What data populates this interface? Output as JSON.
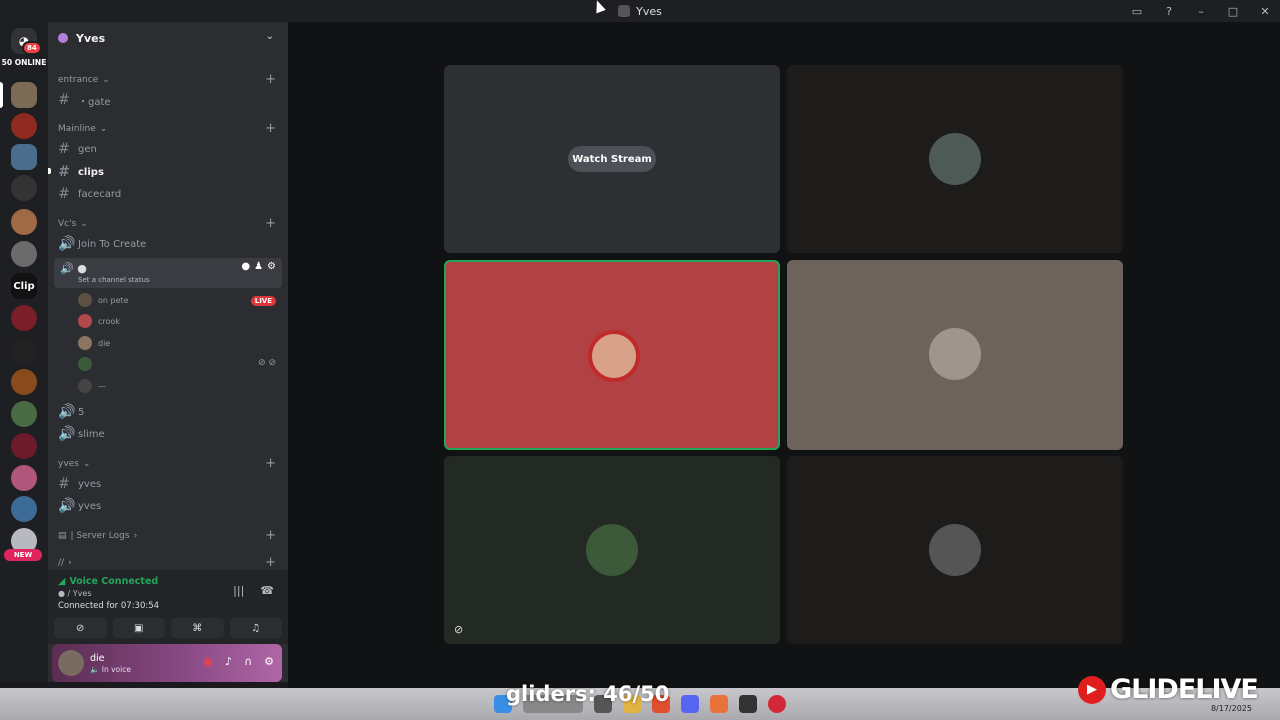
{
  "window": {
    "title": "Yves"
  },
  "rail": {
    "home_badge": "84",
    "online_label": "50 ONLINE",
    "clip_label": "Clip",
    "new_label": "NEW"
  },
  "guild": {
    "name": "Yves"
  },
  "categories": {
    "entrance": "entrance",
    "mainline": "Mainline",
    "vcs": "Vc's",
    "yves": "yves",
    "server_logs": "| Server Logs",
    "slash": "//"
  },
  "channels": {
    "gate": "・gate",
    "gen": "gen",
    "clips": "clips",
    "facecard": "facecard",
    "join_to_create": "Join To Create",
    "five": "5",
    "slime": "slime",
    "yves_text": "yves",
    "yves_voice": "yves"
  },
  "active_vc": {
    "status_placeholder": "Set a channel status"
  },
  "members": [
    {
      "name": "on pete",
      "live": "LIVE"
    },
    {
      "name": "crook"
    },
    {
      "name": "die"
    },
    {
      "name": ""
    },
    {
      "name": "—"
    }
  ],
  "voice": {
    "connected_label": "Voice Connected",
    "channel_path": "/ Yves",
    "connected_for_label": "Connected for",
    "duration": "07:30:54"
  },
  "user": {
    "name": "die",
    "status": "In voice"
  },
  "stage": {
    "watch_label": "Watch Stream"
  },
  "overlay": {
    "gliders": "gliders: 46/50",
    "brand": "GLIDELIVE",
    "date": "8/17/2025"
  },
  "colors": {
    "speaking_tile": "#b24144",
    "tile_brown": "#6e625c",
    "tile_dark": "#1d1c1b",
    "tile_gray": "#2e2f33",
    "tile_green": "#232923",
    "voice_green": "#23a55a"
  }
}
